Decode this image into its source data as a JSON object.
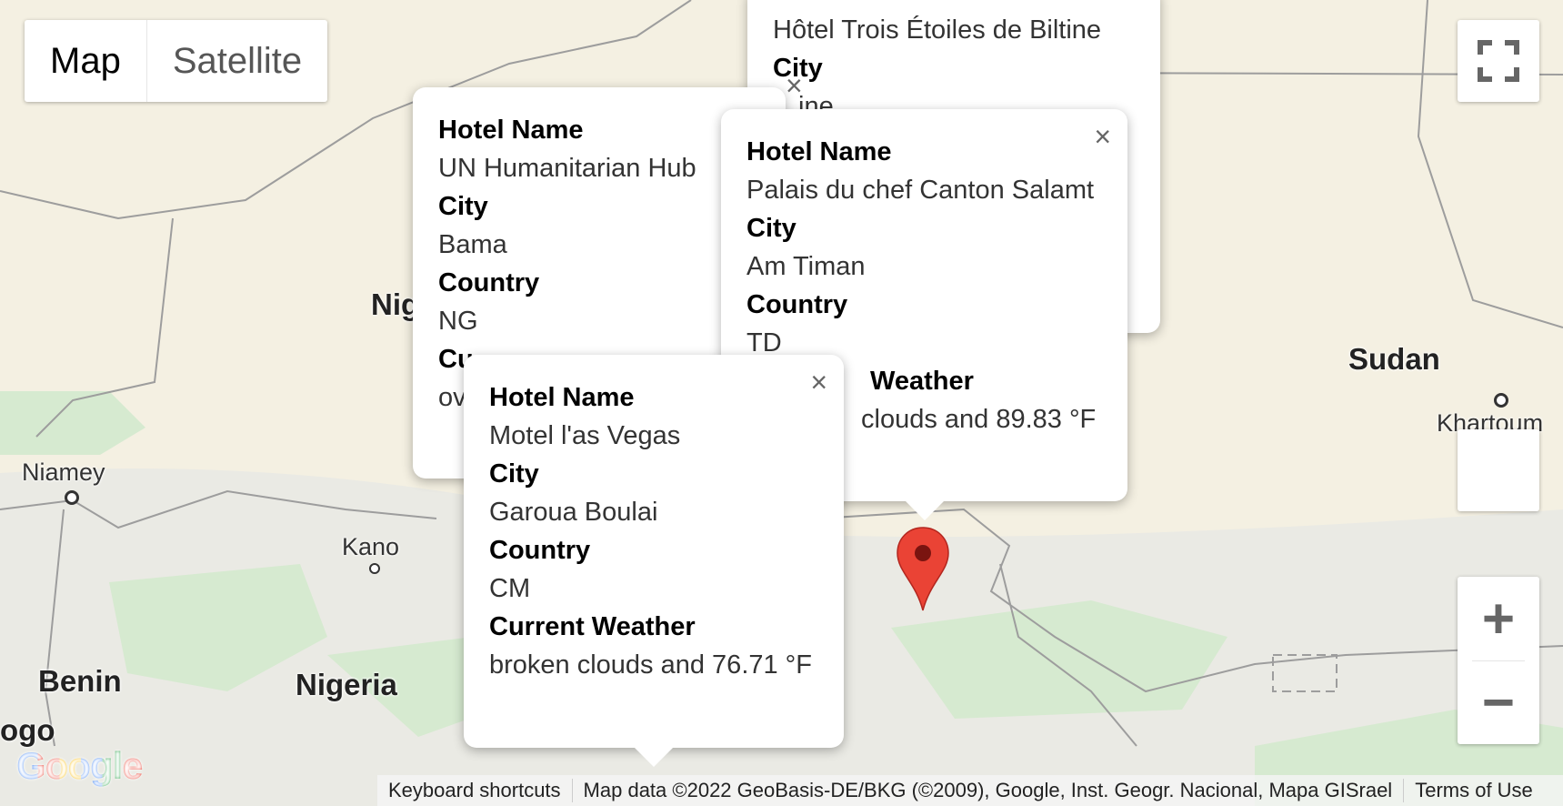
{
  "map_type": {
    "map_label": "Map",
    "satellite_label": "Satellite"
  },
  "places": {
    "countries": [
      "Sudan",
      "Benin",
      "Nigeria",
      "Nig",
      "ogo"
    ],
    "cities": [
      "Niamey",
      "Kano",
      "Khartoum"
    ]
  },
  "info_windows": [
    {
      "hotel_name_label": "Hotel Name",
      "hotel_name": "Hôtel Trois Étoiles de Biltine",
      "city_label": "City",
      "city": "ine"
    },
    {
      "hotel_name_label": "Hotel Name",
      "hotel_name": "UN Humanitarian Hub",
      "city_label": "City",
      "city": "Bama",
      "country_label": "Country",
      "country": "NG",
      "weather_label_visible": "Cu",
      "weather_visible": "ov"
    },
    {
      "hotel_name_label": "Hotel Name",
      "hotel_name": "Palais du chef Canton Salamt",
      "city_label": "City",
      "city": "Am Timan",
      "country_label": "Country",
      "country": "TD",
      "weather_label_visible": "Weather",
      "weather_visible": "clouds and 89.83 °F"
    },
    {
      "hotel_name_label": "Hotel Name",
      "hotel_name": "Motel l'as Vegas",
      "city_label": "City",
      "city": "Garoua Boulai",
      "country_label": "Country",
      "country": "CM",
      "weather_label": "Current Weather",
      "weather": "broken clouds and 76.71 °F"
    }
  ],
  "footer": {
    "keyboard_shortcuts": "Keyboard shortcuts",
    "map_data": "Map data ©2022 GeoBasis-DE/BKG (©2009), Google, Inst. Geogr. Nacional, Mapa GISrael",
    "terms": "Terms of Use"
  },
  "controls": {
    "zoom_in": "+",
    "zoom_out": "−",
    "close": "×",
    "logo": "Google"
  },
  "colors": {
    "land": "#f3efe0",
    "marker": "#ea4335",
    "forest": "#cfe6c4"
  }
}
